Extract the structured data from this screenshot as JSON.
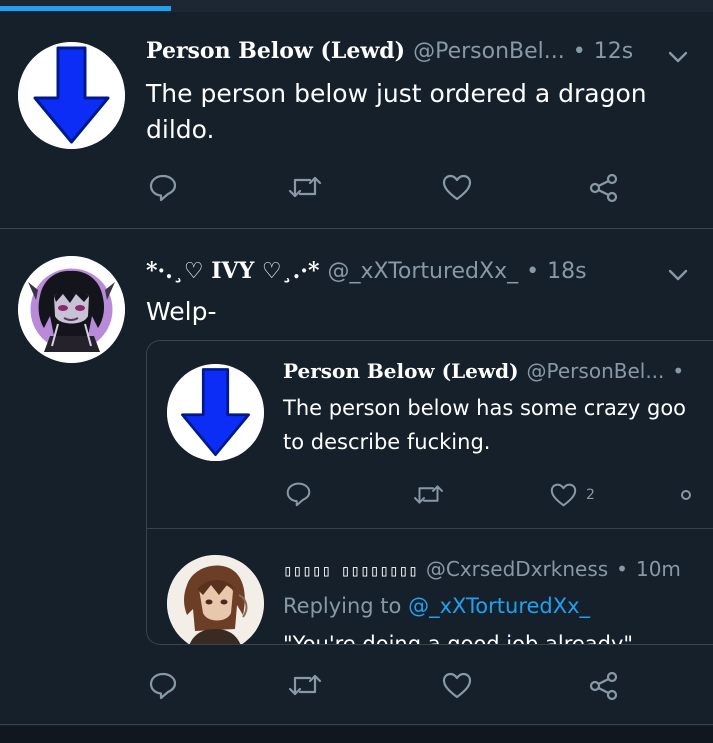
{
  "colors": {
    "background": "#15202b",
    "border": "#38444d",
    "accent": "#1da1f2",
    "muted": "#8899a6",
    "arrow_blue": "#0b2df5"
  },
  "loading_progress": 0.24,
  "tweets": [
    {
      "display_name": "Person Below (Lewd)",
      "handle": "@PersonBel...",
      "separator": "•",
      "time": "12s",
      "text_lines": [
        "The person below just ordered a dragon",
        "dildo."
      ],
      "avatar": "blue-down-arrow-icon",
      "actions": [
        "reply-icon",
        "retweet-icon",
        "like-icon",
        "share-icon"
      ]
    },
    {
      "display_name": "*·.¸♡ IVY ♡¸.·*",
      "handle": "@_xXTorturedXx_",
      "separator": "•",
      "time": "18s",
      "text": "Welp-",
      "avatar": "anime-character-avatar",
      "actions": [
        "reply-icon",
        "retweet-icon",
        "like-icon",
        "share-icon"
      ],
      "quoted_tweet": {
        "display_name": "Person Below (Lewd)",
        "handle": "@PersonBel...",
        "separator": "•",
        "text_lines": [
          "The person below has some crazy goo",
          "to describe fucking."
        ],
        "like_count": "2",
        "avatar": "blue-down-arrow-icon"
      },
      "quoted_reply": {
        "display_name": "▯▯▯▯▯ ▯▯▯▯▯▯▯▯",
        "handle": "@CxrsedDxrkness",
        "separator": "•",
        "time": "10m",
        "replying_prefix": "Replying to",
        "replying_handle": "@_xXTorturedXx_",
        "text_partial": "\"You're doing a good job already\"",
        "avatar": "brown-hair-character-avatar"
      }
    }
  ]
}
